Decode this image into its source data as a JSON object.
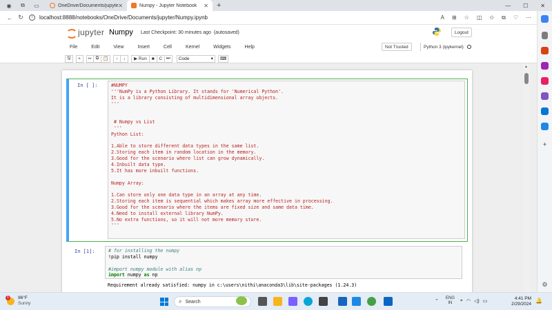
{
  "browser": {
    "tabs": [
      {
        "title": "OneDrive/Documents/jupyter/",
        "active": false
      },
      {
        "title": "Numpy - Jupyter Notebook",
        "active": true
      }
    ],
    "new_tab": "+",
    "url": "localhost:8888/notebooks/OneDrive/Documents/jupyter/Numpy.ipynb",
    "controls": {
      "minimize": "—",
      "maximize": "☐",
      "close": "✕"
    }
  },
  "jupyter": {
    "brand": "jupyter",
    "notebook_name": "Numpy",
    "checkpoint": "Last Checkpoint: 30 minutes ago",
    "autosave": "(autosaved)",
    "logout": "Logout",
    "menu": [
      "File",
      "Edit",
      "View",
      "Insert",
      "Cell",
      "Kernel",
      "Widgets",
      "Help"
    ],
    "trust": "Not Trusted",
    "kernel": "Python 3 (ipykernel)",
    "toolbar": {
      "save": "🖫",
      "add": "+",
      "cut": "✂",
      "copy": "⧉",
      "paste": "📋",
      "up": "↑",
      "down": "↓",
      "run": "▶ Run",
      "stop": "■",
      "restart": "C",
      "fastforward": "⏭",
      "cell_type": "Code",
      "keyboard": "⌨"
    }
  },
  "cells": [
    {
      "prompt": "In [ ]:",
      "lines": [
        "#NUMPY",
        "'''NumPy is a Python Library. It stands for 'Numerical Python'.",
        "It is a library consisting of multidimensional array objects.",
        "'''",
        "",
        "",
        " # Numpy vs List",
        " '''",
        "Python List:",
        "",
        "1.Able to store different data types in the same list.",
        "2.Storing each item in random location in the memory.",
        "3.Good for the scenario where list can grow dynamically.",
        "4.Inbuilt data type.",
        "5.It has more inbuilt functions.",
        "",
        "Numpy Array:",
        "",
        "1.Can store only one data type in an array at any time.",
        "2.Storing each item is sequential which makes array more effective in processing.",
        "3.Good for the scenario where the items are fixed size and same data time.",
        "4.Need to install external library NumPy.",
        "5.No extra functions, so it will not more memory store.",
        "'''"
      ]
    },
    {
      "prompt": "In [1]:",
      "line1": "# for installing the numpy",
      "line2": "!pip install numpy",
      "line3": "",
      "line4": "#import numpy module with alias np",
      "line5_kw1": "import",
      "line5_mid": " numpy ",
      "line5_kw2": "as",
      "line5_end": " np",
      "output": "Requirement already satisfied: numpy in c:\\users\\nithi\\anaconda3\\lib\\site-packages (1.24.3)"
    }
  ],
  "taskbar": {
    "temperature": "96°F",
    "condition": "Sunny",
    "badge": "1",
    "search": "Search",
    "lang1": "ENG",
    "lang2": "IN",
    "time": "4:41 PM",
    "date": "2/29/2024"
  },
  "colors": {
    "jupyter_orange": "#f37626",
    "selected_border": "#42a5f5",
    "string_red": "#ba2121",
    "comment": "#408080",
    "keyword": "#008000"
  }
}
